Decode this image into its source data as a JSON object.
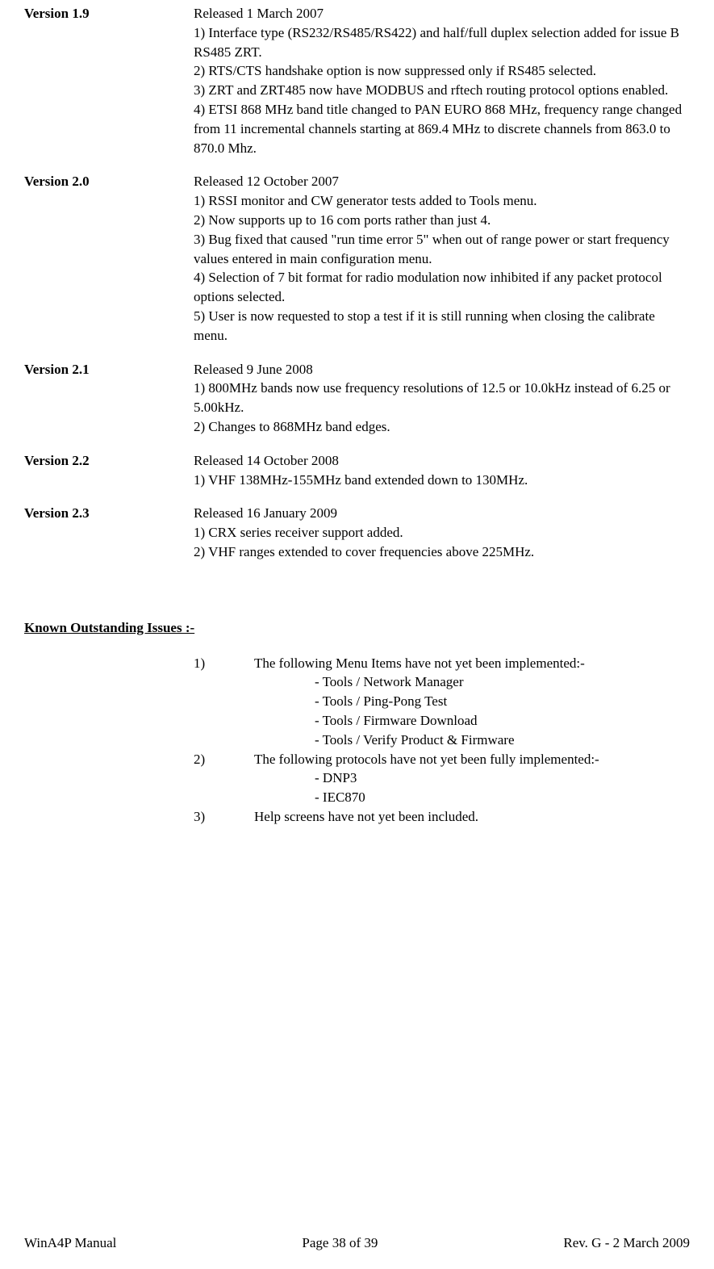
{
  "versions": [
    {
      "label": "Version 1.9",
      "body": "Released  1 March 2007\n1)  Interface type (RS232/RS485/RS422) and half/full duplex selection added for issue B RS485 ZRT.\n2) RTS/CTS handshake option is now suppressed only if RS485 selected.\n3) ZRT and ZRT485 now have MODBUS and rftech routing protocol options enabled.\n4) ETSI 868 MHz band title changed to PAN EURO 868 MHz, frequency range changed from 11 incremental channels starting at 869.4 MHz to discrete channels from 863.0 to 870.0 Mhz."
    },
    {
      "label": "Version 2.0",
      "body": "Released  12 October 2007\n1)  RSSI monitor and CW generator tests added to Tools menu.\n2) Now supports up to 16 com ports rather than just 4.\n3) Bug fixed that caused \"run time error 5\" when out of range power or start frequency values entered in main configuration menu.\n4) Selection of 7 bit format for radio modulation now inhibited if any packet protocol options selected.\n5) User is now requested to stop a test if it is still running when closing the calibrate menu."
    },
    {
      "label": "Version 2.1",
      "body": "Released   9 June 2008\n1) 800MHz bands now use frequency resolutions of 12.5 or 10.0kHz instead of 6.25 or 5.00kHz.\n2) Changes to 868MHz band edges."
    },
    {
      "label": "Version 2.2",
      "body": "Released  14 October 2008\n1)  VHF 138MHz-155MHz band extended down to 130MHz."
    },
    {
      "label": "Version 2.3",
      "body": "Released  16 January 2009\n1)  CRX series receiver support added.\n2)  VHF ranges extended to cover frequencies above 225MHz."
    }
  ],
  "known_issues_heading": "Known Outstanding Issues :-",
  "issues": [
    {
      "num": "1)",
      "text": "The following Menu Items have not yet been implemented:-",
      "subs": [
        "- Tools / Network Manager",
        "- Tools / Ping-Pong Test",
        "- Tools / Firmware Download",
        "- Tools / Verify Product & Firmware"
      ]
    },
    {
      "num": "2)",
      "text": "The following protocols have not yet been fully implemented:-",
      "subs": [
        "- DNP3",
        "- IEC870"
      ]
    },
    {
      "num": "3)",
      "text": "Help screens have not yet been included.",
      "subs": []
    }
  ],
  "footer": {
    "left": "WinA4P Manual",
    "center": "Page 38 of 39",
    "right": "Rev. G -  2 March 2009"
  }
}
